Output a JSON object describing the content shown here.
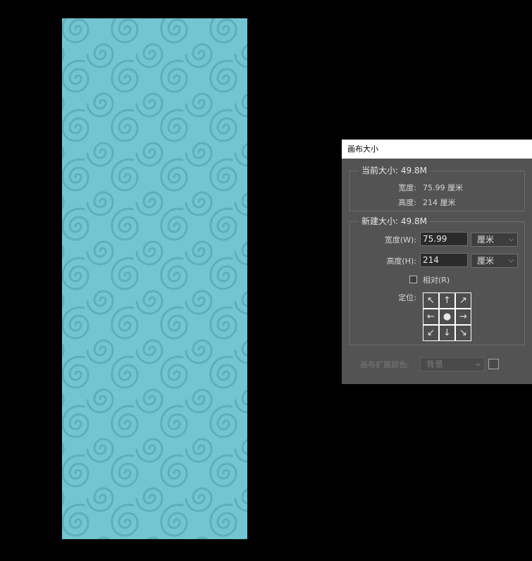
{
  "dialog": {
    "title": "画布大小",
    "current_size": {
      "legend": "当前大小: 49.8M",
      "width_label": "宽度:",
      "width_value": "75.99 厘米",
      "height_label": "高度:",
      "height_value": "214 厘米"
    },
    "new_size": {
      "legend": "新建大小: 49.8M",
      "width_label": "宽度(W):",
      "width_value": "75.99",
      "width_unit": "厘米",
      "height_label": "高度(H):",
      "height_value": "214",
      "height_unit": "厘米",
      "relative_label": "相对(R)",
      "relative_checked": false,
      "anchor_label": "定位:",
      "anchor_arrows": [
        "↖",
        "↑",
        "↗",
        "←",
        "●",
        "→",
        "↙",
        "↓",
        "↘"
      ]
    },
    "extension_color": {
      "label": "画布扩展颜色:",
      "value": "背景",
      "enabled": false
    }
  },
  "canvas": {
    "background_color": "#72c5d1",
    "pattern_color": "#5cb0bc"
  },
  "icons": {
    "dropdown": "chevron-down-icon"
  }
}
